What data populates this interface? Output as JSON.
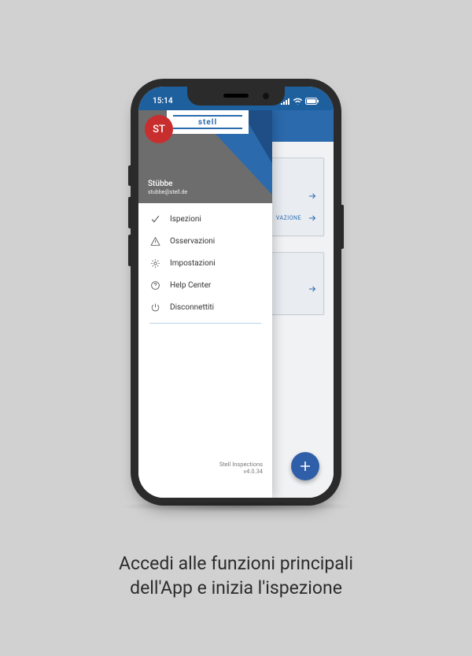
{
  "status": {
    "time": "15:14"
  },
  "logo": {
    "text": "stell"
  },
  "avatar": {
    "initials": "ST"
  },
  "profile": {
    "name": "Stübbe",
    "email": "stubbe@stell.de"
  },
  "menu": {
    "items": [
      {
        "label": "Ispezioni"
      },
      {
        "label": "Osservazioni"
      },
      {
        "label": "Impostazioni"
      },
      {
        "label": "Help Center"
      },
      {
        "label": "Disconnettiti"
      }
    ]
  },
  "footer": {
    "line1": "Stell Inspections",
    "line2": "v4.0.34"
  },
  "background_cards": {
    "card_a_row2_label": "VAZIONE"
  },
  "caption": {
    "line1": "Accedi alle funzioni principali",
    "line2": "dell'App e inizia l'ispezione"
  }
}
